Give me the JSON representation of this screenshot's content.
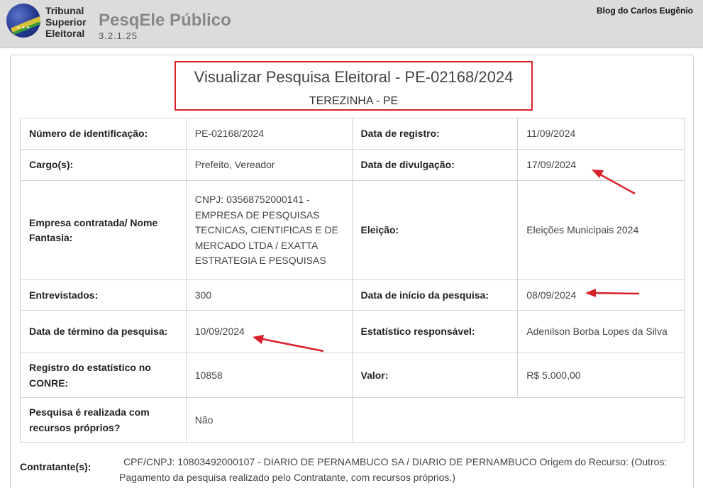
{
  "header": {
    "logo_lines": [
      "Tribunal",
      "Superior",
      "Eleitoral"
    ],
    "app_title": "PesqEle Público",
    "version": "3.2.1.25",
    "watermark": "Blog do Carlos Eugênio"
  },
  "page": {
    "title": "Visualizar Pesquisa Eleitoral - PE-02168/2024",
    "location": "TEREZINHA - PE"
  },
  "fields": {
    "numero_label": "Número de identificação:",
    "numero_value": "PE-02168/2024",
    "registro_label": "Data de registro:",
    "registro_value": "11/09/2024",
    "cargo_label": "Cargo(s):",
    "cargo_value": "Prefeito, Vereador",
    "divulgacao_label": "Data de divulgação:",
    "divulgacao_value": "17/09/2024",
    "empresa_label": "Empresa contratada/ Nome Fantasia:",
    "empresa_value": "CNPJ: 03568752000141 - EMPRESA DE PESQUISAS TECNICAS, CIENTIFICAS E DE MERCADO LTDA / EXATTA ESTRATEGIA E PESQUISAS",
    "eleicao_label": "Eleição:",
    "eleicao_value": "Eleições Municipais 2024",
    "entrevistados_label": "Entrevistados:",
    "entrevistados_value": "300",
    "inicio_label": "Data de início da pesquisa:",
    "inicio_value": "08/09/2024",
    "termino_label": "Data de término da pesquisa:",
    "termino_value": "10/09/2024",
    "estatistico_label": "Estatístico responsável:",
    "estatistico_value": "Adenilson Borba Lopes da Silva",
    "conre_label": "Registro do estatístico no CONRE:",
    "conre_value": "10858",
    "valor_label": "Valor:",
    "valor_value": "R$ 5.000,00",
    "proprios_label": "Pesquisa é realizada com recursos próprios?",
    "proprios_value": "Não"
  },
  "contratante": {
    "label": "Contratante(s):",
    "text": "CPF/CNPJ: 10803492000107 - DIARIO DE PERNAMBUCO SA / DIARIO DE PERNAMBUCO Origem do Recurso: (Outros: Pagamento da pesquisa realizado pelo Contratante, com recursos próprios.)"
  },
  "colors": {
    "highlight": "#d9202a",
    "header_bg": "#dcdcdc"
  }
}
